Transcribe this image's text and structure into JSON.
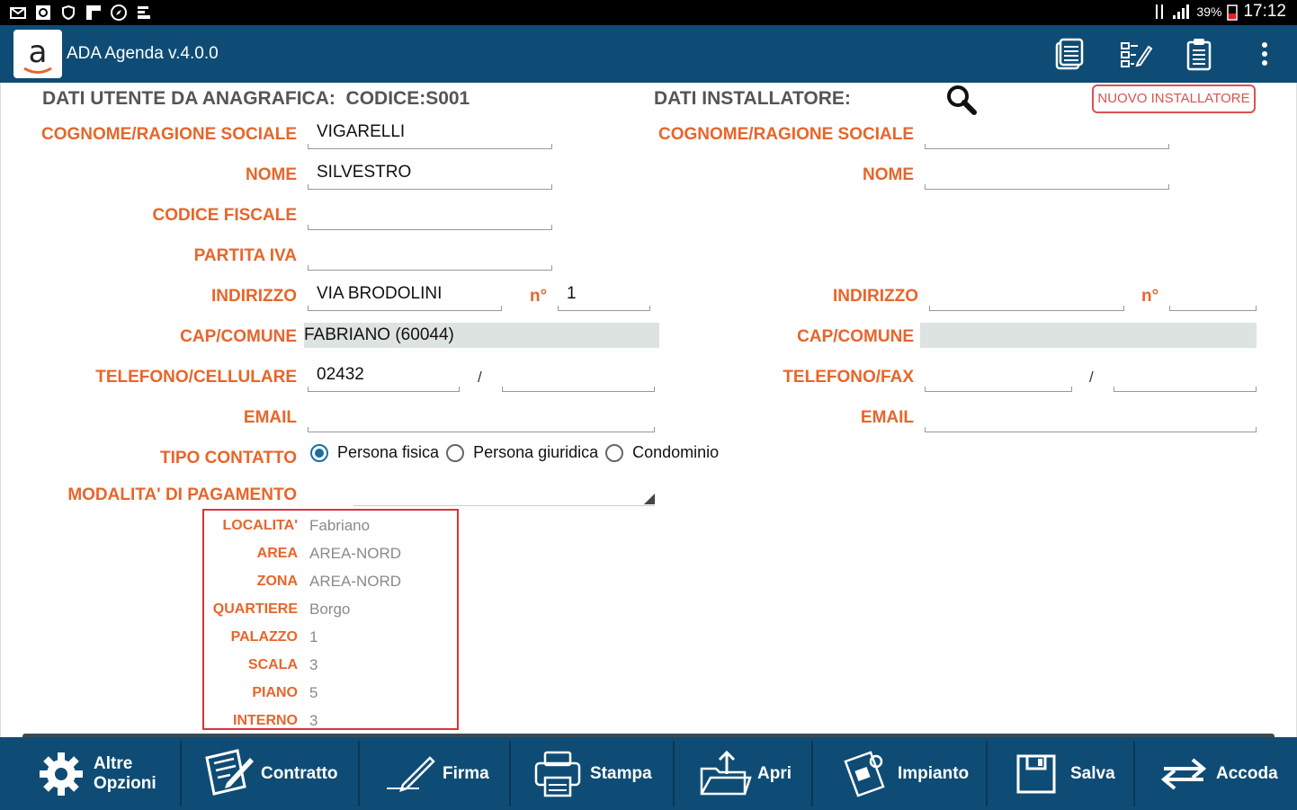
{
  "status_bar": {
    "battery": "39%",
    "time": "17:12"
  },
  "app": {
    "title": "ADA Agenda v.4.0.0",
    "logo_letter": "a"
  },
  "user_section": {
    "header": "DATI UTENTE DA ANAGRAFICA:",
    "codice": "CODICE:S001",
    "labels": {
      "cognome": "COGNOME/RAGIONE SOCIALE",
      "nome": "NOME",
      "codice_fiscale": "CODICE FISCALE",
      "partita_iva": "PARTITA IVA",
      "indirizzo": "INDIRIZZO",
      "numero": "n°",
      "cap_comune": "CAP/COMUNE",
      "telefono": "TELEFONO/CELLULARE",
      "email": "EMAIL",
      "tipo_contatto": "TIPO CONTATTO",
      "modalita": "MODALITA' DI PAGAMENTO"
    },
    "values": {
      "cognome": "VIGARELLI",
      "nome": "SILVESTRO",
      "codice_fiscale": "",
      "partita_iva": "",
      "indirizzo": "VIA BRODOLINI",
      "numero": "1",
      "cap_comune": "FABRIANO (60044)",
      "telefono": "02432",
      "cellulare": "",
      "email": "",
      "modalita": ""
    },
    "slash": "/",
    "tipo_contatto_options": [
      "Persona fisica",
      "Persona giuridica",
      "Condominio"
    ],
    "tipo_contatto_selected": "Persona fisica"
  },
  "installer_section": {
    "header": "DATI INSTALLATORE:",
    "new_button": "NUOVO INSTALLATORE",
    "labels": {
      "cognome": "COGNOME/RAGIONE SOCIALE",
      "nome": "NOME",
      "indirizzo": "INDIRIZZO",
      "numero": "n°",
      "cap_comune": "CAP/COMUNE",
      "telefono": "TELEFONO/FAX",
      "email": "EMAIL"
    },
    "values": {
      "cognome": "",
      "nome": "",
      "indirizzo": "",
      "numero": "",
      "cap_comune": "",
      "telefono": "",
      "fax": "",
      "email": ""
    },
    "slash": "/"
  },
  "location_box": {
    "rows": [
      {
        "label": "LOCALITA'",
        "value": "Fabriano"
      },
      {
        "label": "AREA",
        "value": "AREA-NORD"
      },
      {
        "label": "ZONA",
        "value": "AREA-NORD"
      },
      {
        "label": "QUARTIERE",
        "value": "Borgo"
      },
      {
        "label": "PALAZZO",
        "value": "1"
      },
      {
        "label": "SCALA",
        "value": "3"
      },
      {
        "label": "PIANO",
        "value": "5"
      },
      {
        "label": "INTERNO",
        "value": "3"
      }
    ]
  },
  "toolbar": {
    "altre_opzioni_1": "Altre",
    "altre_opzioni_2": "Opzioni",
    "contratto": "Contratto",
    "firma": "Firma",
    "stampa": "Stampa",
    "apri": "Apri",
    "impianto": "Impianto",
    "salva": "Salva",
    "accoda": "Accoda"
  }
}
